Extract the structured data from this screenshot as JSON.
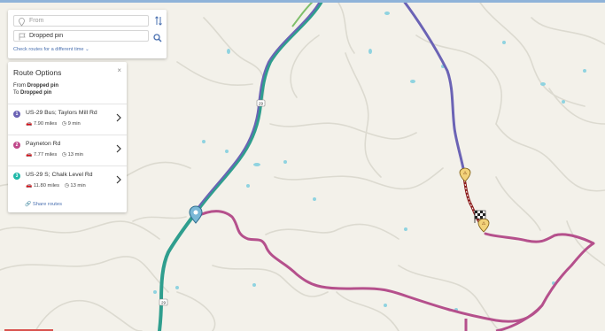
{
  "search": {
    "from_placeholder": "From",
    "to_value": "Dropped pin",
    "check_link": "Check routes for a different time",
    "check_link_chevron": "⌄"
  },
  "panel": {
    "title": "Route Options",
    "close_glyph": "×",
    "from_label": "From",
    "from_value": "Dropped pin",
    "to_label": "To",
    "to_value": "Dropped pin",
    "share_label": "Share routes"
  },
  "routes": [
    {
      "num": "1",
      "name": "US-29 Bus; Taylors Mill Rd",
      "distance": "7.90 miles",
      "time": "9 min",
      "color": "#6b63b5"
    },
    {
      "num": "2",
      "name": "Payneton Rd",
      "distance": "7.77 miles",
      "time": "13 min",
      "color": "#c0488a"
    },
    {
      "num": "3",
      "name": "US-29 S; Chalk Level Rd",
      "distance": "11.80 miles",
      "time": "13 min",
      "color": "#1fb8a8"
    }
  ],
  "map": {
    "road_labels": [
      "29",
      "29"
    ],
    "colors": {
      "route1": "#6b63b5",
      "route2": "#b5508c",
      "route3": "#2f9e8e",
      "traffic": "#8b1a1a",
      "water": "#8fd3e0",
      "road": "#dcdad0"
    },
    "icons": [
      "map-pin-icon",
      "checkered-flag-icon",
      "traffic-warning-icon"
    ]
  }
}
